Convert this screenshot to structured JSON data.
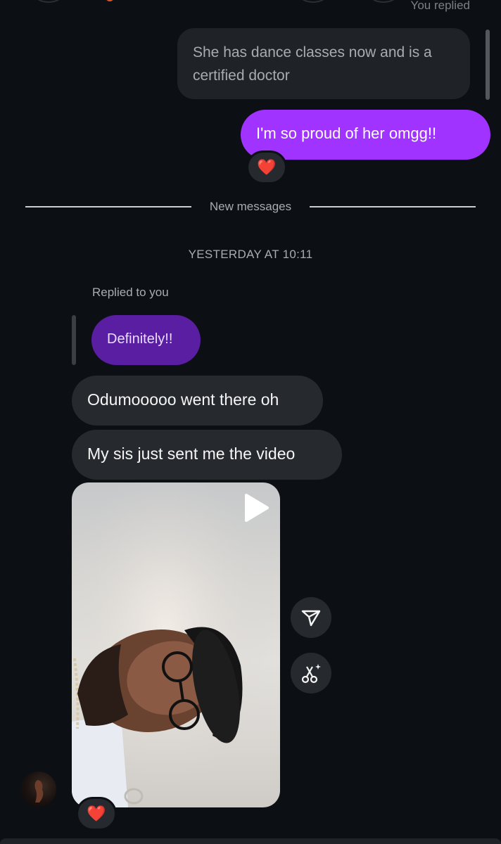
{
  "header": {
    "status_text": "You replied"
  },
  "messages": {
    "outgoing_1": "She has dance classes now and is a certified doctor",
    "outgoing_2": "I'm so proud of her omgg!!",
    "reaction_1": "❤️",
    "divider_label": "New messages",
    "timestamp": "YESTERDAY AT 10:11",
    "replied_label": "Replied to you",
    "quoted_reply": "Definitely!!",
    "incoming_1": "Odumooooo went there oh",
    "incoming_2": "My sis just sent me the video",
    "reaction_2": "❤️"
  },
  "video": {
    "play_icon": "play-icon"
  },
  "actions": {
    "share_icon": "share-icon",
    "remix_icon": "remix-icon"
  },
  "colors": {
    "background": "#0c1014",
    "outgoing_bubble": "#a033ff",
    "quoted_bubble": "#5a1ea3",
    "incoming_bubble": "#262a2f",
    "reaction": "#ff2a3d"
  }
}
